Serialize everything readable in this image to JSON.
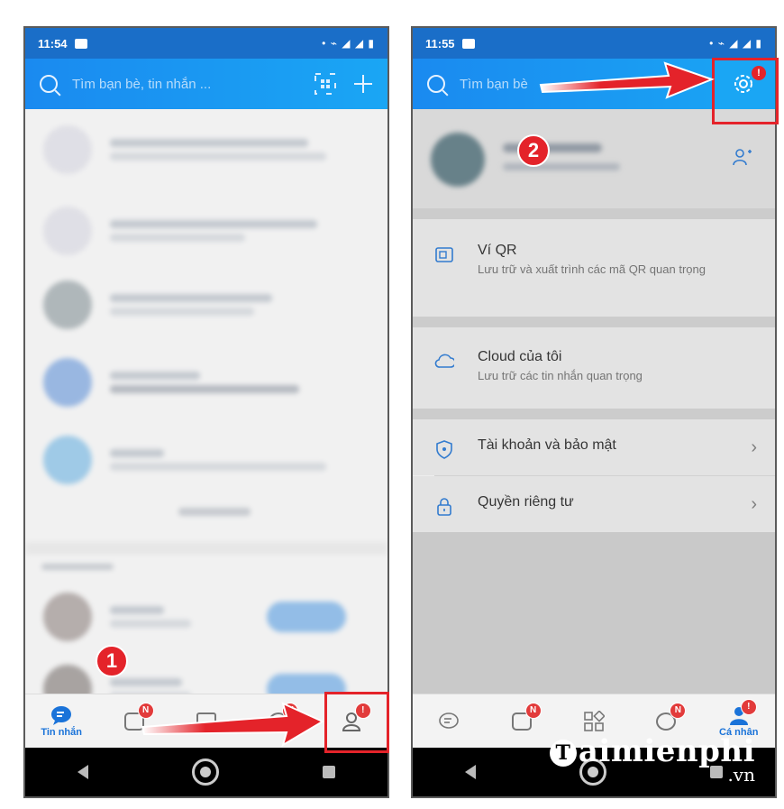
{
  "left": {
    "status_time": "11:54",
    "search_placeholder": "Tìm bạn bè, tin nhắn ...",
    "bottom_nav": {
      "messages_label": "Tin nhắn",
      "badge_n": "N",
      "badge_alert": "!"
    },
    "callout_number": "1"
  },
  "right": {
    "status_time": "11:55",
    "search_placeholder": "Tìm bạn bè",
    "callout_number": "2",
    "menu": [
      {
        "title": "Ví QR",
        "subtitle": "Lưu trữ và xuất trình các mã QR quan trọng",
        "icon": "qr-wallet-icon"
      },
      {
        "title": "Cloud của tôi",
        "subtitle": "Lưu trữ các tin nhắn quan trọng",
        "icon": "cloud-icon"
      },
      {
        "title": "Tài khoản và bảo mật",
        "icon": "shield-icon"
      },
      {
        "title": "Quyền riêng tư",
        "icon": "lock-icon"
      }
    ],
    "bottom_nav": {
      "personal_label": "Cá nhân",
      "badge_n": "N",
      "badge_alert": "!"
    }
  },
  "watermark": {
    "brand": "aimienphi",
    "suffix": ".vn"
  },
  "colors": {
    "accent": "#1a8af0",
    "highlight": "#e4232a"
  }
}
